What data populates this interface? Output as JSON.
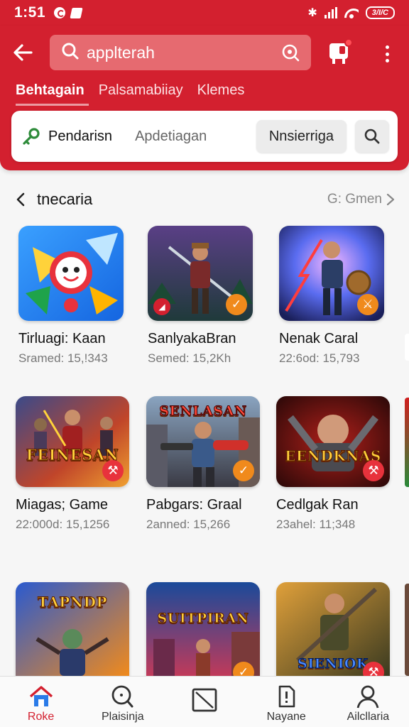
{
  "status_bar": {
    "time": "1:51",
    "battery": "3/I/C",
    "bluetooth": "✱"
  },
  "header": {
    "search_text": "applterah",
    "tabs": [
      {
        "label": "Behtagain",
        "active": true
      },
      {
        "label": "Palsamabiiay",
        "active": false
      },
      {
        "label": "Klemes",
        "active": false
      }
    ]
  },
  "filter": {
    "primary": "Pendarisn",
    "secondary": "Apdetiagan",
    "button": "Nnsierriga"
  },
  "section": {
    "title": "tnecaria",
    "more": "G: Gmen"
  },
  "games": [
    {
      "title": "Tirluagi: Kaan",
      "meta": "Sramed: 15,!343",
      "banner": ""
    },
    {
      "title": "SanlyakaBran",
      "meta": "Semed: 15,2Kh",
      "banner": ""
    },
    {
      "title": "Nenak Caral",
      "meta": "22:6od: 15,793",
      "banner": ""
    },
    {
      "title": "Miagas; Game",
      "meta": "22:000d: 15,1256",
      "banner": "FEINESAN"
    },
    {
      "title": "Pabgars: Graal",
      "meta": "2anned: 15,266",
      "banner": "SENLASAN"
    },
    {
      "title": "Cedlgak Ran",
      "meta": "23ahel: 11;348",
      "banner": "EENDKNAS"
    },
    {
      "title": "",
      "meta": "",
      "banner": "TAPNDP"
    },
    {
      "title": "",
      "meta": "",
      "banner": "SUITPIRAN"
    },
    {
      "title": "",
      "meta": "",
      "banner": "SIENIOK"
    }
  ],
  "bottom_nav": [
    {
      "label": "Roke",
      "icon": "home-icon",
      "active": true
    },
    {
      "label": "Plaisinja",
      "icon": "search-icon",
      "active": false
    },
    {
      "label": "",
      "icon": "library-icon",
      "active": false
    },
    {
      "label": "Nayane",
      "icon": "notification-icon",
      "active": false
    },
    {
      "label": "Ailcllaria",
      "icon": "account-icon",
      "active": false
    }
  ],
  "colors": {
    "brand": "#d3202f",
    "search_bg": "#e66a70",
    "active_nav": "#d3202f"
  }
}
